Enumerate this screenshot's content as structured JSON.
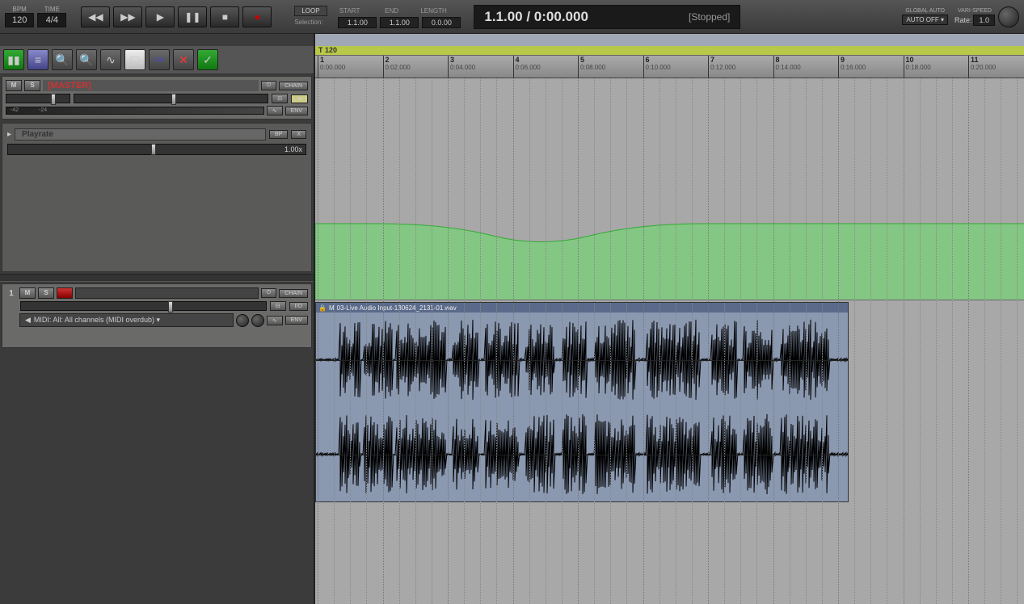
{
  "transport": {
    "bpm_label": "BPM",
    "bpm_value": "120",
    "time_label": "TIME",
    "time_value": "4/4",
    "loop_label": "LOOP",
    "start_label": "START",
    "end_label": "END",
    "length_label": "LENGTH",
    "selection_label": "Selection:",
    "sel_start": "1.1.00",
    "sel_end": "1.1.00",
    "sel_len": "0.0.00",
    "position": "1.1.00 / 0:00.000",
    "status": "[Stopped]",
    "global_auto_label": "GLOBAL AUTO",
    "global_auto_value": "AUTO OFF ▾",
    "varispeed_label": "VARI-SPEED",
    "rate_label": "Rate:",
    "rate_value": "1.0"
  },
  "master": {
    "name": "[MASTER]",
    "m": "M",
    "s": "S",
    "chain": "CHAIN",
    "env": "ENV",
    "scale_a": "-42",
    "scale_b": "-24"
  },
  "playrate": {
    "chevron": "▸",
    "title": "Playrate",
    "bp": "BP",
    "x": "X",
    "value": "1.00x"
  },
  "track1": {
    "num": "1",
    "m": "M",
    "s": "S",
    "chain": "CHAIN",
    "io": "I/O",
    "env": "ENV",
    "midi": "MIDI: All: All channels (MIDI overdub) ▾"
  },
  "timeline": {
    "tempo_marker": "T 120",
    "marks": [
      {
        "bar": "1",
        "time": "0:00.000"
      },
      {
        "bar": "2",
        "time": "0:02.000"
      },
      {
        "bar": "3",
        "time": "0:04.000"
      },
      {
        "bar": "4",
        "time": "0:06.000"
      },
      {
        "bar": "5",
        "time": "0:08.000"
      },
      {
        "bar": "6",
        "time": "0:10.000"
      },
      {
        "bar": "7",
        "time": "0:12.000"
      },
      {
        "bar": "8",
        "time": "0:14.000"
      },
      {
        "bar": "9",
        "time": "0:16.000"
      },
      {
        "bar": "10",
        "time": "0:18.000"
      },
      {
        "bar": "11",
        "time": "0:20.000"
      }
    ],
    "clip_name": "03-Live Audio Input-130624_2131-01.wav"
  }
}
